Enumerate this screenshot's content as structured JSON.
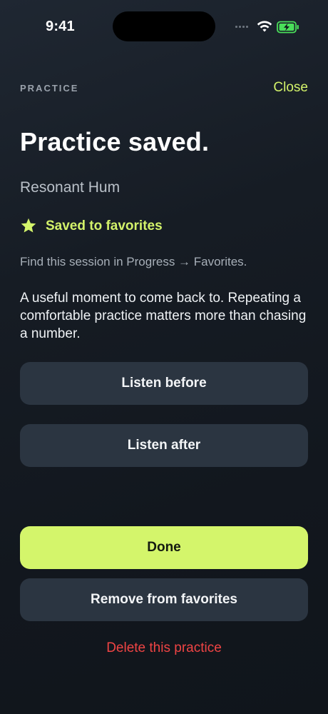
{
  "status_bar": {
    "time": "9:41",
    "icons": [
      "cellular-signal-icon",
      "wifi-icon",
      "battery-charging-icon"
    ],
    "battery_color": "#4ade5a"
  },
  "header": {
    "eyebrow": "PRACTICE",
    "close_label": "Close"
  },
  "main": {
    "title": "Practice saved.",
    "subtitle": "Resonant Hum",
    "favorite_status": {
      "icon": "star-icon",
      "label": "Saved to favorites"
    },
    "hint": "Find this session in Progress → Favorites.",
    "message": "A useful moment to come back to. Repeating a comfortable practice matters more than chasing a number."
  },
  "buttons": {
    "listen_before": "Listen before",
    "listen_after": "Listen after",
    "done": "Done",
    "remove_favorite": "Remove from favorites",
    "delete": "Delete this practice"
  },
  "colors": {
    "accent": "#d4f56b",
    "danger": "#ef4444",
    "button_bg": "#2b3541",
    "background": "#161c24"
  }
}
